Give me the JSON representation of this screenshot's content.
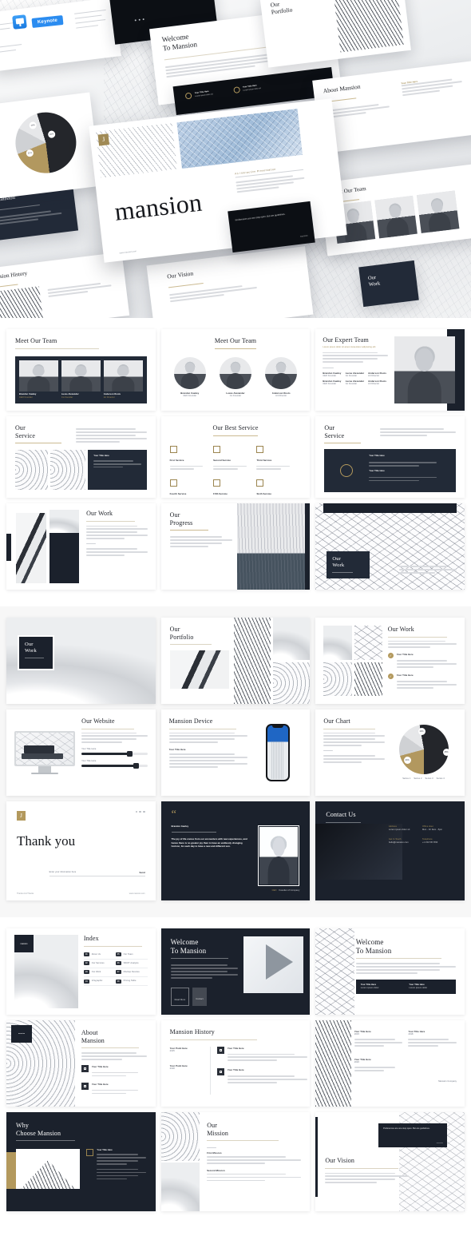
{
  "product": {
    "name": "mansion",
    "format_badge": "Keynote",
    "tagline_kicker": "An Interactive Presentation"
  },
  "hero": {
    "title": "mansion",
    "badge": "Keynote",
    "slide_labels": {
      "welcome": "Welcome\nTo Mansion",
      "welcome_line1": "Welcome",
      "welcome_line2": "To Mansion",
      "about_mansion": "About Mansion",
      "our_portfolio": "Our\nPortfolio",
      "portfolio_l1": "Our",
      "portfolio_l2": "Portfolio",
      "meet_our_team": "Meet Our Team",
      "mansion_history": "Mansion History",
      "our_vision": "Our Vision",
      "our_work_l1": "Our",
      "our_work_l2": "Work",
      "welcome_mansion_l1": "me",
      "welcome_mansion_l2": "Mansion"
    },
    "footer_note": "www.mansion.com",
    "dark_card_text": "Preferences are one stop open. But are guidelines.",
    "dark_card_brand": "mansion"
  },
  "sections": [
    {
      "id": "section-team-service-work",
      "rows": [
        {
          "id": "row-team",
          "slides": [
            {
              "id": "meet-our-team-dark",
              "title": "Meet Our Team",
              "layout": "team-band",
              "members": [
                {
                  "name": "Brandon Cawley",
                  "role": "CEO Founder"
                },
                {
                  "name": "Lucas Alexander",
                  "role": "Co Founder"
                },
                {
                  "name": "Anderson Roots",
                  "role": "Art Director"
                }
              ]
            },
            {
              "id": "meet-our-team-circles",
              "title": "Meet Our Team",
              "layout": "team-circles",
              "members": [
                {
                  "name": "Brandon Cawley",
                  "role": "CEO Founder"
                },
                {
                  "name": "Lucas Alexander",
                  "role": "Co Founder"
                },
                {
                  "name": "Anderson Roots",
                  "role": "Art Director"
                }
              ]
            },
            {
              "id": "our-expert-team",
              "title": "Our Expert Team",
              "layout": "expert-team",
              "subtitle": "Lorem ipsum dolor sit amet consectetur adipiscing elit",
              "body": "Lorem ipsum dolor sit amet consectetur adipiscing elit sed do eiusmod tempor incididunt ut labore et dolore magna aliqua enim ad minim veniam quis nostrud.",
              "members": [
                {
                  "name": "Brandon Cawley",
                  "role": "CEO Founder"
                },
                {
                  "name": "Lucas Alexander",
                  "role": "Co Founder"
                },
                {
                  "name": "Anderson Roots",
                  "role": "Art Director"
                },
                {
                  "name": "Brandon Cawley",
                  "role": "CEO Founder"
                },
                {
                  "name": "Lucas Alexander",
                  "role": "Co Founder"
                },
                {
                  "name": "Anderson Roots",
                  "role": "Art Director"
                }
              ]
            }
          ]
        },
        {
          "id": "row-service",
          "slides": [
            {
              "id": "our-service-photos",
              "title_l1": "Our",
              "title_l2": "Service",
              "layout": "service-photos",
              "body": "Lorem ipsum dolor sit amet consectetur adipiscing elit sed do eiusmod tempor incididunt ut labore et dolore magna aliqua ut enim ad minim veniam quis nostrud exercitation.",
              "card_title": "Your Title Here",
              "card_body": "Lorem ipsum dolor sit amet consectetur adipiscing elit sed do eiusmod tempor incididunt ut labore."
            },
            {
              "id": "our-best-service",
              "title": "Our Best Service",
              "layout": "service-icons",
              "items": [
                {
                  "icon": "bank-icon",
                  "label": "First Service",
                  "body": "Lorem ipsum dolor sit amet consectetur adipiscing elit sed do eiusmod."
                },
                {
                  "icon": "crane-icon",
                  "label": "Second Service",
                  "body": "Lorem ipsum dolor sit amet consectetur adipiscing elit sed do eiusmod."
                },
                {
                  "icon": "blueprint-icon",
                  "label": "Third Service",
                  "body": "Lorem ipsum dolor sit amet consectetur adipiscing elit sed do eiusmod."
                },
                {
                  "icon": "house-icon",
                  "label": "Fourth Service",
                  "body": "Lorem ipsum dolor sit amet consectetur adipiscing elit sed do eiusmod."
                },
                {
                  "icon": "document-icon",
                  "label": "Fifth Service",
                  "body": "Lorem ipsum dolor sit amet consectetur adipiscing elit sed do eiusmod."
                },
                {
                  "icon": "window-icon",
                  "label": "Sixth Service",
                  "body": "Lorem ipsum dolor sit amet consectetur adipiscing elit sed do eiusmod."
                }
              ]
            },
            {
              "id": "our-service-dark",
              "title_l1": "Our",
              "title_l2": "Service",
              "layout": "service-dark",
              "body": "Lorem ipsum dolor sit amet consectetur adipiscing elit sed do eiusmod tempor.",
              "items": [
                {
                  "label": "Your Title Here",
                  "body": "Lorem ipsum dolor sit amet consectetur adipiscing elit sed do eiusmod tempor incididunt."
                },
                {
                  "label": "Your Title Here",
                  "body": "Lorem ipsum dolor sit amet consectetur adipiscing elit sed do eiusmod tempor incididunt."
                }
              ]
            }
          ]
        },
        {
          "id": "row-work",
          "slides": [
            {
              "id": "our-work-photos",
              "title": "Our Work",
              "layout": "work-photos",
              "body": "Lorem ipsum dolor sit amet consectetur adipiscing elit sed do eiusmod tempor incididunt ut labore et dolore magna aliqua ut enim ad minim veniam quis nostrud exercitation ullamco.",
              "body2": "Lorem ipsum dolor sit amet consectetur adipiscing elit sed do eiusmod tempor."
            },
            {
              "id": "our-progress",
              "title_l1": "Our",
              "title_l2": "Progress",
              "layout": "progress",
              "body": "Lorem ipsum dolor sit amet consectetur adipiscing elit sed do eiusmod tempor incididunt ut labore et dolore magna aliqua."
            },
            {
              "id": "our-work-mesh",
              "title_l1": "Our",
              "title_l2": "Work",
              "layout": "work-mesh",
              "body": "Lorem ipsum dolor sit amet consectetur adipiscing elit sed do eiusmod tempor incididunt ut labore."
            }
          ]
        }
      ]
    },
    {
      "id": "section-portfolio-chart-thanks",
      "rows": [
        {
          "id": "row-portfolio",
          "slides": [
            {
              "id": "our-work-cover",
              "title_l1": "Our",
              "title_l2": "Work",
              "layout": "work-cover"
            },
            {
              "id": "our-portfolio",
              "title_l1": "Our",
              "title_l2": "Portfolio",
              "layout": "portfolio"
            },
            {
              "id": "our-work-checklist",
              "title": "Our Work",
              "layout": "work-checklist",
              "body": "Lorem ipsum dolor sit amet consectetur adipiscing elit sed do eiusmod tempor incididunt ut labore.",
              "items": [
                {
                  "label": "Your Title Here",
                  "body": "Lorem ipsum dolor sit amet consectetur adipiscing elit sed do eiusmod tempor incididunt ut labore."
                },
                {
                  "label": "Your Title Here",
                  "body": "Lorem ipsum dolor sit amet consectetur adipiscing elit sed do eiusmod tempor incididunt ut labore."
                }
              ]
            }
          ]
        },
        {
          "id": "row-device-chart",
          "slides": [
            {
              "id": "our-website",
              "title": "Our Website",
              "layout": "website",
              "body": "Lorem ipsum dolor sit amet consectetur adipiscing elit sed do eiusmod tempor incididunt ut labore et dolore magna aliqua ut enim ad minim veniam.",
              "bars": [
                {
                  "label": "Your Title Here",
                  "icon": "download-icon"
                },
                {
                  "label": "Your Title Here",
                  "icon": "shield-icon"
                }
              ]
            },
            {
              "id": "mansion-device",
              "title": "Mansion Device",
              "layout": "device",
              "body": "Lorem ipsum dolor sit amet consectetur adipiscing elit sed do eiusmod tempor incididunt ut labore et dolore magna aliqua ut enim ad minim.",
              "sub_label": "Your Title Here",
              "body2": "Lorem ipsum dolor sit amet consectetur adipiscing elit sed do eiusmod tempor incididunt ut labore et dolore magna aliqua ut enim ad minim veniam quis nostrud."
            },
            {
              "id": "our-chart",
              "title": "Our Chart",
              "layout": "chart",
              "body": "Lorem ipsum dolor sit amet consectetur adipiscing elit sed do eiusmod tempor incididunt ut labore et dolore magna.",
              "body2": "Lorem ipsum dolor sit amet consectetur adipiscing elit."
            }
          ]
        },
        {
          "id": "row-thanks",
          "slides": [
            {
              "id": "thank-you",
              "title": "Thank you",
              "layout": "thankyou",
              "footer_left": "Thanks And Thanks",
              "footer_right": "www.mansion.com",
              "field_label": "Enter your information here",
              "field_action": "Send"
            },
            {
              "id": "quote",
              "layout": "quote",
              "quote_mark": "“",
              "author": "Brandon Cawley",
              "text": "The joy of life comes from our encounters with new experiences, and hence there is no greater joy than to have an endlessly changing horizon, for each day to have a new and different sun.",
              "credit_role": "CEO",
              "credit_company": "Founder of Company"
            },
            {
              "id": "contact-us",
              "title": "Contact Us",
              "layout": "contact",
              "items": [
                {
                  "label": "Address",
                  "value": "Lorem ipsum dolor sit"
                },
                {
                  "label": "Office Hour",
                  "value": "Mon - Fri 9am - 5pm"
                },
                {
                  "label": "Get In Touch",
                  "value": "hello@mansion.com"
                },
                {
                  "label": "Telephone",
                  "value": "+1 234 567 890"
                }
              ]
            }
          ]
        }
      ]
    },
    {
      "id": "section-index-about-vision",
      "rows": [
        {
          "id": "row-index",
          "slides": [
            {
              "id": "index",
              "title": "Index",
              "layout": "index",
              "brand_tag": "mansion",
              "items": [
                {
                  "num": "01",
                  "label": "About Us"
                },
                {
                  "num": "05",
                  "label": "Our Team"
                },
                {
                  "num": "02",
                  "label": "Our Services"
                },
                {
                  "num": "06",
                  "label": "SWOT Analysis"
                },
                {
                  "num": "03",
                  "label": "Our Work"
                },
                {
                  "num": "07",
                  "label": "Mockup Devices"
                },
                {
                  "num": "04",
                  "label": "Infographic"
                },
                {
                  "num": "08",
                  "label": "Pricing Table"
                }
              ]
            },
            {
              "id": "welcome-to-mansion-dark",
              "title_l1": "Welcome",
              "title_l2": "To Mansion",
              "layout": "welcome-dark",
              "body": "Lorem ipsum dolor sit amet consectetur adipiscing elit sed do eiusmod tempor incididunt ut labore et dolore magna aliqua. Ut enim ad minim veniam quis nostrud exercitation ullamco laboris nisi ut aliquip ex ea commodo consequat.",
              "buttons": [
                "Read More",
                "Contact"
              ]
            },
            {
              "id": "welcome-to-mansion-light",
              "title_l1": "Welcome",
              "title_l2": "To Mansion",
              "layout": "welcome-light",
              "body": "Lorem ipsum dolor sit amet consectetur adipiscing elit sed do eiusmod tempor incididunt ut labore et dolore magna aliqua ut enim.",
              "cards": [
                {
                  "label": "Your Title Here",
                  "body": "Lorem ipsum dolor"
                },
                {
                  "label": "Your Title Here",
                  "body": "Lorem ipsum dolor"
                }
              ]
            }
          ]
        },
        {
          "id": "row-about-history",
          "slides": [
            {
              "id": "about-mansion",
              "title_l1": "About",
              "title_l2": "Mansion",
              "layout": "about",
              "brand_tag": "mansion",
              "body": "Lorem ipsum dolor sit amet consectetur adipiscing elit sed do eiusmod tempor incididunt ut labore et dolore magna aliqua.",
              "items": [
                {
                  "icon": "building-icon",
                  "label": "Your Title Here",
                  "body": "Lorem ipsum dolor sit amet consectetur adipiscing elit sed do eiusmod."
                },
                {
                  "icon": "blueprint-icon",
                  "label": "Your Title Here",
                  "body": "Lorem ipsum dolor sit amet consectetur adipiscing elit sed do eiusmod."
                }
              ]
            },
            {
              "id": "mansion-history",
              "title": "Mansion History",
              "layout": "history",
              "entries": [
                {
                  "year": "Your Point Here",
                  "sub": "2015",
                  "icon": "calendar-icon",
                  "label": "Your Title Here",
                  "body": "Lorem ipsum dolor sit amet consectetur adipiscing elit sed do eiusmod tempor incididunt ut labore et dolore magna."
                },
                {
                  "year": "Your Point Here",
                  "sub": "2018",
                  "icon": "chart-icon",
                  "label": "Your Title Here",
                  "body": "Lorem ipsum dolor sit amet consectetur adipiscing elit sed do eiusmod tempor incididunt ut labore et dolore magna."
                }
              ]
            },
            {
              "id": "mansion-company",
              "layout": "company",
              "caption": "Mansion Company",
              "entries": [
                {
                  "label": "Your Title Here",
                  "sub": "2015"
                },
                {
                  "label": "Your Title Here",
                  "sub": "2018"
                },
                {
                  "label": "Your Title Here",
                  "sub": "2020"
                }
              ]
            }
          ]
        },
        {
          "id": "row-why-mission-vision",
          "slides": [
            {
              "id": "why-choose-mansion",
              "title_l1": "Why",
              "title_l2": "Choose Mansion",
              "layout": "why-dark",
              "item_label": "Your Title Here",
              "body": "Lorem ipsum dolor sit amet consectetur adipiscing elit sed do eiusmod tempor incididunt ut labore et dolore magna aliqua. Ut enim ad minim veniam.",
              "body2": "Lorem ipsum dolor sit amet consectetur adipiscing elit sed do eiusmod tempor incididunt ut labore et dolore magna aliqua ut enim."
            },
            {
              "id": "our-mission",
              "title_l1": "Our",
              "title_l2": "Mission",
              "layout": "mission",
              "sections": [
                {
                  "label": "First Mission",
                  "body": "Lorem ipsum dolor sit amet consectetur adipiscing elit sed do eiusmod tempor incididunt ut labore et dolore magna aliqua ut enim ad minim."
                },
                {
                  "label": "Second Mission",
                  "body": "Lorem ipsum dolor sit amet consectetur adipiscing elit sed do eiusmod tempor incididunt ut labore et dolore magna aliqua ut enim ad minim."
                }
              ]
            },
            {
              "id": "our-vision",
              "title": "Our Vision",
              "layout": "vision",
              "card_text": "Preferences are one stop open. But are guidelines.",
              "card_brand": "mansion",
              "body": "Lorem ipsum dolor sit amet consectetur adipiscing elit sed do eiusmod tempor incididunt ut labore et dolore magna aliqua. Ut enim ad minim veniam quis nostrud exercitation."
            }
          ]
        }
      ]
    }
  ],
  "chart_data": {
    "type": "pie",
    "title": "Our Chart",
    "categories": [
      "Series 1",
      "Series 2",
      "Series 3",
      "Series 4"
    ],
    "values": [
      45,
      21,
      14,
      20
    ],
    "labels": [
      "45%",
      "21%",
      "14%",
      "20%"
    ],
    "colors": [
      "#24262b",
      "#b2985f",
      "#cfd1d4",
      "#e6e7e9"
    ],
    "legend_position": "bottom",
    "legend": [
      "Series 1",
      "Series 2",
      "Series 3",
      "Series 4"
    ]
  },
  "theme": {
    "accent_gold": "#b3995d",
    "dark_navy": "#222a37",
    "near_black": "#1b212c",
    "badge_blue": "#2b8cf0",
    "page_bg": "#ffffff",
    "band_alt_bg": "#f7f7f7"
  }
}
